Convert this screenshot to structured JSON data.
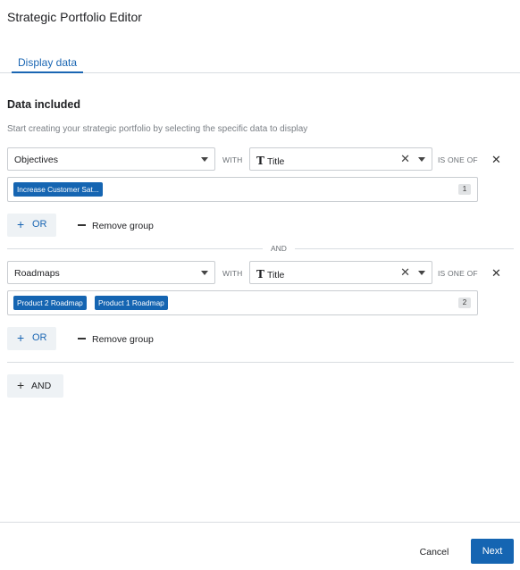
{
  "dialog": {
    "title": "Strategic Portfolio Editor"
  },
  "tabs": [
    {
      "label": "Display data",
      "active": true
    }
  ],
  "section": {
    "title": "Data included",
    "description": "Start creating your strategic portfolio by selecting the specific data to display"
  },
  "groups": [
    {
      "entity": "Objectives",
      "with_label": "WITH",
      "field": "Title",
      "field_icon": "text-type-icon",
      "operator": "IS ONE OF",
      "values": [
        "Increase Customer Sat..."
      ],
      "count": "1",
      "or_button": "OR",
      "remove_button": "Remove group"
    },
    {
      "entity": "Roadmaps",
      "with_label": "WITH",
      "field": "Title",
      "field_icon": "text-type-icon",
      "operator": "IS ONE OF",
      "values": [
        "Product 2 Roadmap",
        "Product 1 Roadmap"
      ],
      "count": "2",
      "or_button": "OR",
      "remove_button": "Remove group"
    }
  ],
  "and_separator": "AND",
  "add_and_button": "AND",
  "footer": {
    "cancel": "Cancel",
    "next": "Next"
  },
  "colors": {
    "accent": "#1565b2",
    "chip": "#1565b2",
    "button_bg": "#eef2f5"
  }
}
